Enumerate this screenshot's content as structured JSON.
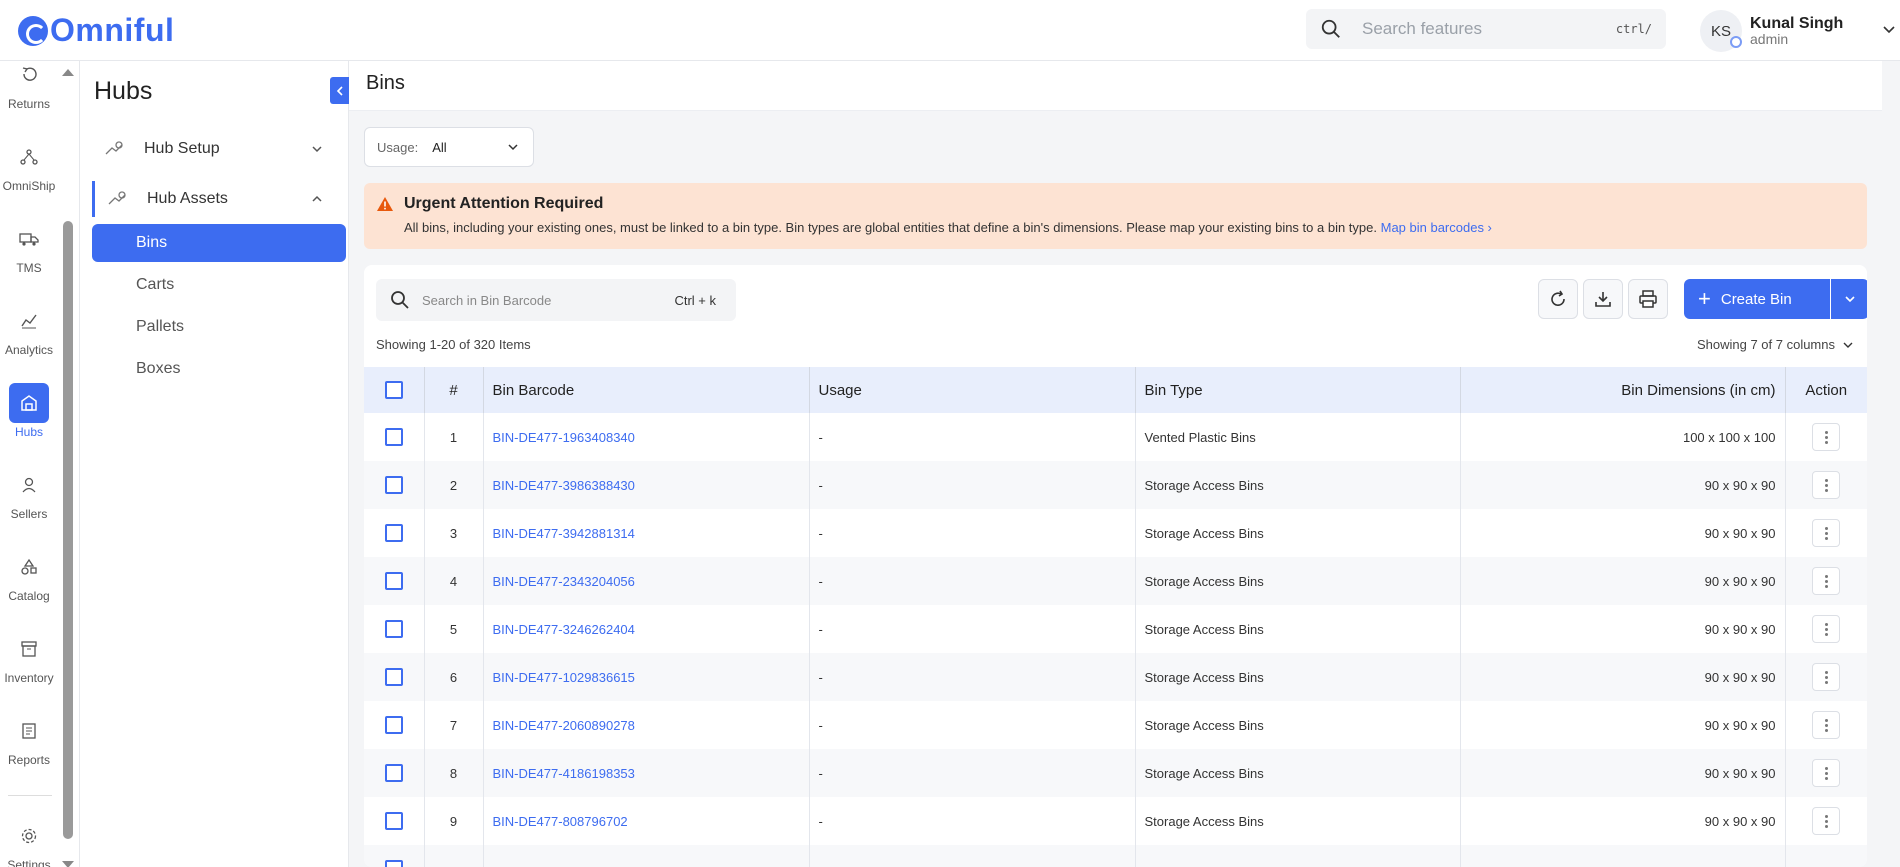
{
  "app": {
    "logo_text": "Omniful"
  },
  "topbar": {
    "search_placeholder": "Search features",
    "search_shortcut": "ctrl/",
    "user": {
      "initials": "KS",
      "name": "Kunal Singh",
      "role": "admin"
    }
  },
  "rail": {
    "items": [
      {
        "label": "Returns",
        "icon": "returns-icon"
      },
      {
        "label": "OmniShip",
        "icon": "omniship-icon"
      },
      {
        "label": "TMS",
        "icon": "truck-icon"
      },
      {
        "label": "Analytics",
        "icon": "analytics-icon"
      },
      {
        "label": "Hubs",
        "icon": "hub-icon",
        "active": true
      },
      {
        "label": "Sellers",
        "icon": "person-icon"
      },
      {
        "label": "Catalog",
        "icon": "shapes-icon"
      },
      {
        "label": "Inventory",
        "icon": "archive-icon"
      },
      {
        "label": "Reports",
        "icon": "report-icon"
      },
      {
        "label": "Settings",
        "icon": "gear-icon"
      }
    ]
  },
  "subnav": {
    "title": "Hubs",
    "groups": [
      {
        "label": "Hub Setup",
        "open": false
      },
      {
        "label": "Hub Assets",
        "open": true
      }
    ],
    "items": [
      "Bins",
      "Carts",
      "Pallets",
      "Boxes"
    ],
    "active_item": "Bins"
  },
  "page": {
    "title": "Bins",
    "usage_filter": {
      "label": "Usage:",
      "value": "All"
    },
    "alert": {
      "title": "Urgent Attention Required",
      "text": "All bins, including your existing ones, must be linked to a bin type. Bin types are global entities that define a bin's dimensions. Please map your existing bins to a bin type.",
      "link": "Map bin barcodes ›"
    },
    "table_search": {
      "placeholder": "Search in Bin Barcode",
      "shortcut": "Ctrl + k"
    },
    "create_button": "Create Bin",
    "showing_text": "Showing 1-20 of 320 Items",
    "columns_text": "Showing 7 of 7 columns",
    "columns": [
      "#",
      "Bin Barcode",
      "Usage",
      "Bin Type",
      "Bin Dimensions (in cm)",
      "Action"
    ],
    "rows": [
      {
        "num": "1",
        "barcode": "BIN-DE477-1963408340",
        "usage": "-",
        "type": "Vented Plastic Bins",
        "dims": "100 x 100 x 100"
      },
      {
        "num": "2",
        "barcode": "BIN-DE477-3986388430",
        "usage": "-",
        "type": "Storage Access Bins",
        "dims": "90 x 90 x 90"
      },
      {
        "num": "3",
        "barcode": "BIN-DE477-3942881314",
        "usage": "-",
        "type": "Storage Access Bins",
        "dims": "90 x 90 x 90"
      },
      {
        "num": "4",
        "barcode": "BIN-DE477-2343204056",
        "usage": "-",
        "type": "Storage Access Bins",
        "dims": "90 x 90 x 90"
      },
      {
        "num": "5",
        "barcode": "BIN-DE477-3246262404",
        "usage": "-",
        "type": "Storage Access Bins",
        "dims": "90 x 90 x 90"
      },
      {
        "num": "6",
        "barcode": "BIN-DE477-1029836615",
        "usage": "-",
        "type": "Storage Access Bins",
        "dims": "90 x 90 x 90"
      },
      {
        "num": "7",
        "barcode": "BIN-DE477-2060890278",
        "usage": "-",
        "type": "Storage Access Bins",
        "dims": "90 x 90 x 90"
      },
      {
        "num": "8",
        "barcode": "BIN-DE477-4186198353",
        "usage": "-",
        "type": "Storage Access Bins",
        "dims": "90 x 90 x 90"
      },
      {
        "num": "9",
        "barcode": "BIN-DE477-808796702",
        "usage": "-",
        "type": "Storage Access Bins",
        "dims": "90 x 90 x 90"
      }
    ]
  },
  "colors": {
    "accent": "#3d6cf0",
    "alert_bg": "#fde3d3",
    "warning": "#e8590c"
  }
}
